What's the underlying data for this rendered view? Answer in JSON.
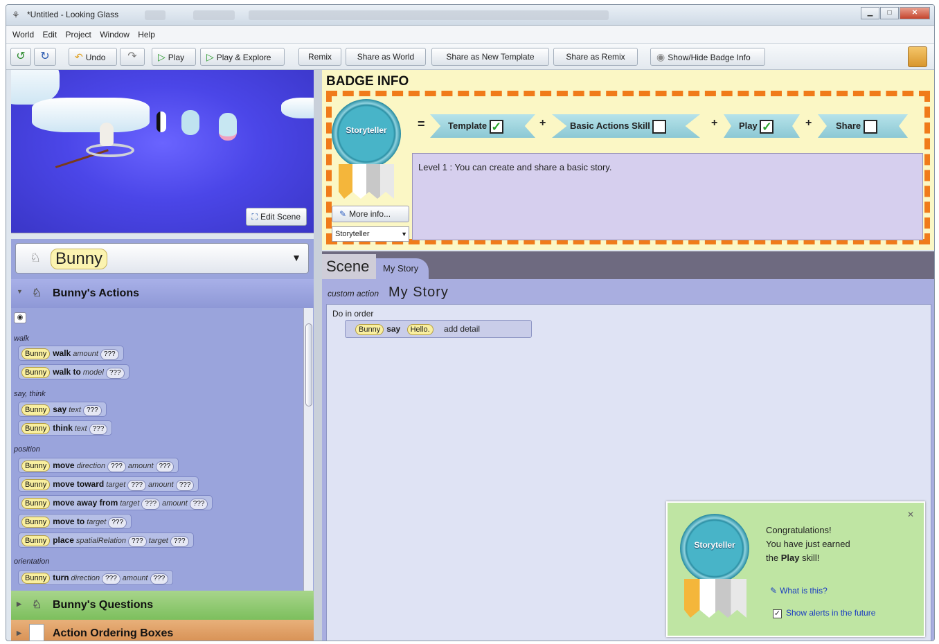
{
  "window": {
    "title": "*Untitled - Looking Glass",
    "icon": "app-icon"
  },
  "menu": [
    "World",
    "Edit",
    "Project",
    "Window",
    "Help"
  ],
  "toolbar": {
    "undo": "Undo",
    "play": "Play",
    "play_explore": "Play & Explore",
    "remix": "Remix",
    "share_world": "Share as World",
    "share_template": "Share as New Template",
    "share_remix": "Share as Remix",
    "badge_info": "Show/Hide Badge Info"
  },
  "world": {
    "edit_scene": "Edit Scene"
  },
  "left": {
    "selected_character": "Bunny",
    "actions_header": "Bunny's Actions",
    "questions_header": "Bunny's Questions",
    "ordering_header": "Action Ordering Boxes",
    "categories": [
      "walk",
      "say, think",
      "position",
      "orientation"
    ],
    "tiles": [
      {
        "who": "Bunny",
        "verb": "walk",
        "params": [
          [
            "amount",
            "???"
          ]
        ]
      },
      {
        "who": "Bunny",
        "verb": "walk to",
        "params": [
          [
            "model",
            "???"
          ]
        ]
      },
      {
        "who": "Bunny",
        "verb": "say",
        "params": [
          [
            "text",
            "???"
          ]
        ]
      },
      {
        "who": "Bunny",
        "verb": "think",
        "params": [
          [
            "text",
            "???"
          ]
        ]
      },
      {
        "who": "Bunny",
        "verb": "move",
        "params": [
          [
            "direction",
            "???"
          ],
          [
            "amount",
            "???"
          ]
        ]
      },
      {
        "who": "Bunny",
        "verb": "move toward",
        "params": [
          [
            "target",
            "???"
          ],
          [
            "amount",
            "???"
          ]
        ]
      },
      {
        "who": "Bunny",
        "verb": "move away from",
        "params": [
          [
            "target",
            "???"
          ],
          [
            "amount",
            "???"
          ]
        ]
      },
      {
        "who": "Bunny",
        "verb": "move to",
        "params": [
          [
            "target",
            "???"
          ]
        ]
      },
      {
        "who": "Bunny",
        "verb": "place",
        "params": [
          [
            "spatialRelation",
            "???"
          ],
          [
            "target",
            "???"
          ]
        ]
      },
      {
        "who": "Bunny",
        "verb": "turn",
        "params": [
          [
            "direction",
            "???"
          ],
          [
            "amount",
            "???"
          ]
        ]
      }
    ]
  },
  "badge": {
    "header": "BADGE INFO",
    "medal": "Storyteller",
    "eq": "=",
    "plus": "+",
    "skills": [
      {
        "label": "Template",
        "checked": true
      },
      {
        "label": "Basic Actions Skill",
        "checked": false
      },
      {
        "label": "Play",
        "checked": true
      },
      {
        "label": "Share",
        "checked": false
      }
    ],
    "check_mark": "✓",
    "level_text": "Level 1 : You can create and share a basic story.",
    "more_info": "More info...",
    "dropdown": "Storyteller"
  },
  "story": {
    "tab_scene": "Scene",
    "tab_mystory": "My Story",
    "custom_action_label": "custom action",
    "custom_action_name": "My Story",
    "do_in_order": "Do in order",
    "statement": {
      "who": "Bunny",
      "verb": "say",
      "text": "Hello.",
      "add_detail": "add detail"
    }
  },
  "congrats": {
    "medal": "Storyteller",
    "line1": "Congratulations!",
    "line2": "You have just earned",
    "line3_prefix": "the",
    "line3_skill": "Play",
    "line3_suffix": "skill!",
    "what_is_this": "What is this?",
    "show_alerts": "Show alerts in the future"
  },
  "colors": {
    "orange_dash": "#f07b1a",
    "world_blue": "#4b46e8",
    "badge_bg": "#fbf7c5"
  }
}
